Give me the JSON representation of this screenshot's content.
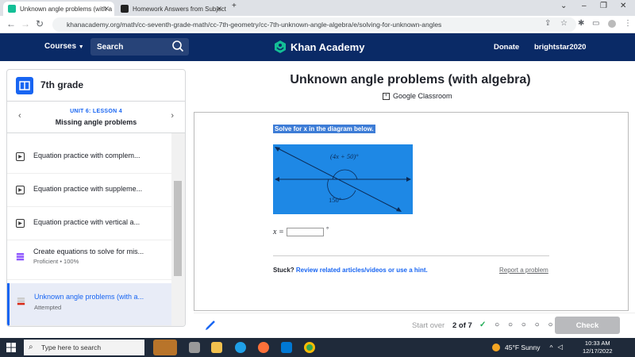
{
  "browser": {
    "tabs": [
      {
        "title": "Unknown angle problems (with a"
      },
      {
        "title": "Homework Answers from Subject"
      }
    ],
    "url": "khanacademy.org/math/cc-seventh-grade-math/cc-7th-geometry/cc-7th-unknown-angle-algebra/e/solving-for-unknown-angles"
  },
  "header": {
    "courses": "Courses",
    "search": "Search",
    "logo": "Khan Academy",
    "donate": "Donate",
    "username": "brightstar2020"
  },
  "sidebar": {
    "course_title": "7th grade",
    "unit_label": "UNIT 6: LESSON 4",
    "lesson_title": "Missing angle problems",
    "items": [
      {
        "label": "Equation practice with complem...",
        "sub": ""
      },
      {
        "label": "Equation practice with suppleme...",
        "sub": ""
      },
      {
        "label": "Equation practice with vertical a...",
        "sub": ""
      },
      {
        "label": "Create equations to solve for mis...",
        "sub": "Proficient • 100%"
      },
      {
        "label": "Unknown angle problems (with a...",
        "sub": "Attempted"
      }
    ]
  },
  "main": {
    "title": "Unknown angle problems (with algebra)",
    "google_classroom": "Google Classroom",
    "prompt": "Solve for x in the diagram below.",
    "diagram": {
      "label_top": "(4x + 50)°",
      "label_bottom": "150°",
      "bg_color": "#1e88e5"
    },
    "answer_var": "x =",
    "answer_value": "",
    "answer_unit": "°",
    "stuck": "Stuck?",
    "hint_link": "Review related articles/videos or use a hint.",
    "report": "Report a problem"
  },
  "footer": {
    "start_over": "Start over",
    "progress": "2 of 7",
    "dots": "✓ ○ ○ ○ ○ ○ ○",
    "check": "Check"
  },
  "taskbar": {
    "search": "Type here to search",
    "weather": "45°F  Sunny",
    "time": "10:33 AM",
    "date": "12/17/2022"
  }
}
